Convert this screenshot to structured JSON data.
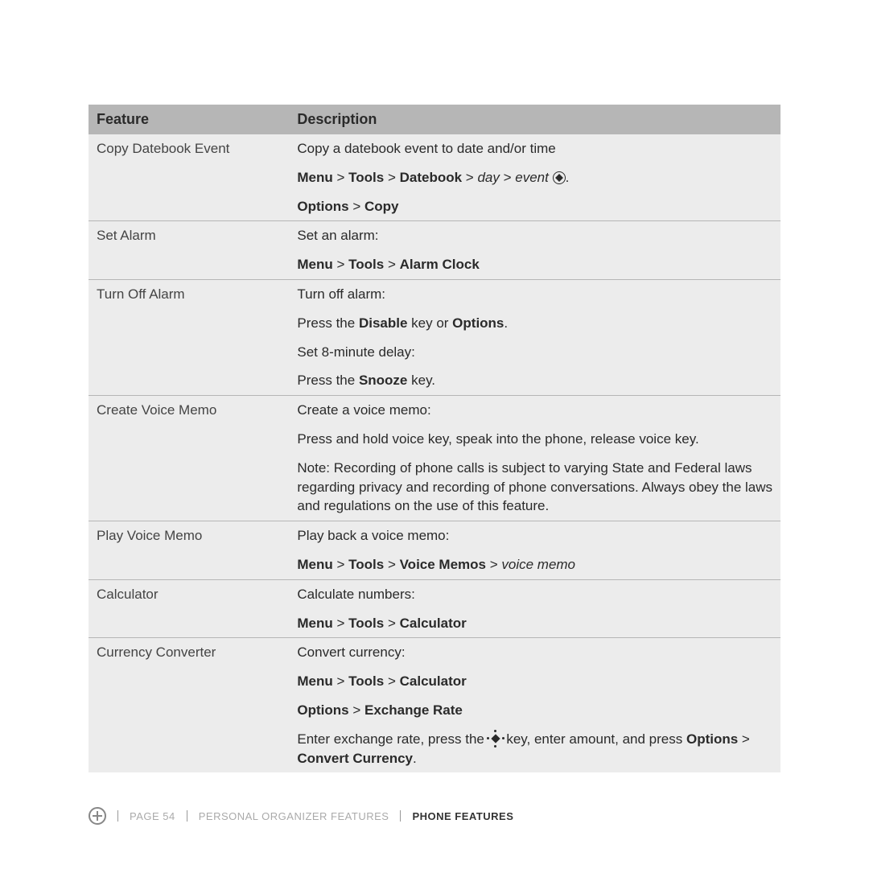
{
  "table": {
    "headers": {
      "feature": "Feature",
      "description": "Description"
    }
  },
  "rows": {
    "copyDatebook": {
      "name": "Copy Datebook Event",
      "l1": "Copy a datebook event to date and/or time",
      "menu": "Menu",
      "tools": "Tools",
      "datebook": "Datebook",
      "day": "day",
      "event": "event",
      "options": "Options",
      "copy": "Copy"
    },
    "setAlarm": {
      "name": "Set Alarm",
      "l1": "Set an alarm:",
      "menu": "Menu",
      "tools": "Tools",
      "alarm": "Alarm Clock"
    },
    "turnOff": {
      "name": "Turn Off Alarm",
      "l1": "Turn off alarm:",
      "l2a": "Press the ",
      "disable": "Disable",
      "l2b": " key or ",
      "options": "Options",
      "l3": "Set 8-minute delay:",
      "l4a": "Press the ",
      "snooze": "Snooze",
      "l4b": " key."
    },
    "voiceCreate": {
      "name": "Create Voice Memo",
      "l1": "Create a voice memo:",
      "l2": "Press and hold voice key, speak into the phone, release voice key.",
      "l3": "Note: Recording of phone calls is subject to varying State and Federal laws regarding privacy and recording of phone conversations. Always obey the laws and regulations on the use of this feature."
    },
    "voicePlay": {
      "name": "Play Voice Memo",
      "l1": "Play back a voice memo:",
      "menu": "Menu",
      "tools": "Tools",
      "vm": "Voice Memos",
      "sel": "voice memo"
    },
    "calc": {
      "name": "Calculator",
      "l1": "Calculate numbers:",
      "menu": "Menu",
      "tools": "Tools",
      "calc": "Calculator"
    },
    "currency": {
      "name": "Currency Converter",
      "l1": "Convert currency:",
      "menu": "Menu",
      "tools": "Tools",
      "calc": "Calculator",
      "options": "Options",
      "rate": "Exchange Rate",
      "l4a": "Enter exchange rate, press the ",
      "l4b": " key, enter amount, and press ",
      "opt2": "Options",
      "cc": "Convert Currency"
    }
  },
  "footer": {
    "page": "PAGE 54",
    "section": "PERSONAL ORGANIZER FEATURES",
    "chapter": "PHONE FEATURES"
  }
}
